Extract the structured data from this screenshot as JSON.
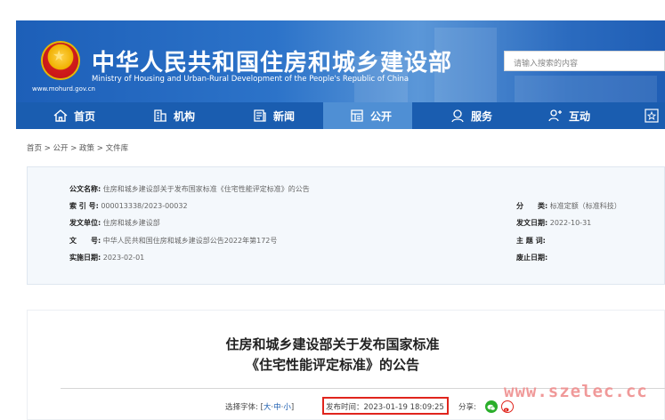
{
  "header": {
    "title_cn": "中华人民共和国住房和城乡建设部",
    "title_en": "Ministry of Housing and Urban-Rural Development of the People's Republic of China",
    "url": "www.mohurd.gov.cn",
    "search_placeholder": "请输入搜索的内容"
  },
  "nav": {
    "items": [
      {
        "label": "首页",
        "icon": "home-icon"
      },
      {
        "label": "机构",
        "icon": "building-icon"
      },
      {
        "label": "新闻",
        "icon": "news-icon"
      },
      {
        "label": "公开",
        "icon": "public-icon"
      },
      {
        "label": "服务",
        "icon": "service-icon"
      },
      {
        "label": "互动",
        "icon": "interact-icon"
      }
    ],
    "active": "公开",
    "colors": {
      "bar": "#1a5db0",
      "active": "#4f8fd4"
    }
  },
  "breadcrumb": "首页 > 公开 > 政策 > 文件库",
  "meta": {
    "doc_name_label": "公文名称:",
    "doc_name_value": "住房和城乡建设部关于发布国家标准《住宅性能评定标准》的公告",
    "index_label": "索 引 号:",
    "index_value": "000013338/2023-00032",
    "category_label": "分　　类:",
    "category_value": "标准定额（标准科技）",
    "issuer_label": "发文单位:",
    "issuer_value": "住房和城乡建设部",
    "issue_date_label": "发文日期:",
    "issue_date_value": "2022-10-31",
    "number_label": "文　　号:",
    "number_value": "中华人民共和国住房和城乡建设部公告2022年第172号",
    "subject_label": "主 题 词:",
    "subject_value": "",
    "effective_label": "实施日期:",
    "effective_value": "2023-02-01",
    "repeal_label": "废止日期:",
    "repeal_value": ""
  },
  "article": {
    "title_line1": "住房和城乡建设部关于发布国家标准",
    "title_line2": "《住宅性能评定标准》的公告",
    "font_label": "选择字体: [",
    "font_large": "大",
    "font_mid": "中",
    "font_small": "小",
    "font_sep": "·",
    "font_close": "]",
    "publish_time": "发布时间：2023-01-19 18:09:25",
    "share_label": "分享:",
    "highlight_color": "#e0251d"
  },
  "watermark": "www.szelec.cc"
}
